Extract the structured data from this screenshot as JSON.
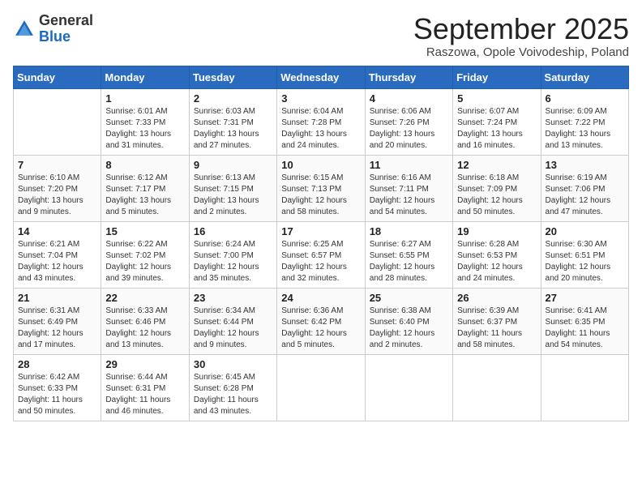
{
  "header": {
    "logo": {
      "general": "General",
      "blue": "Blue"
    },
    "title": "September 2025",
    "subtitle": "Raszowa, Opole Voivodeship, Poland"
  },
  "weekdays": [
    "Sunday",
    "Monday",
    "Tuesday",
    "Wednesday",
    "Thursday",
    "Friday",
    "Saturday"
  ],
  "weeks": [
    [
      {
        "day": "",
        "sunrise": "",
        "sunset": "",
        "daylight": ""
      },
      {
        "day": "1",
        "sunrise": "Sunrise: 6:01 AM",
        "sunset": "Sunset: 7:33 PM",
        "daylight": "Daylight: 13 hours and 31 minutes."
      },
      {
        "day": "2",
        "sunrise": "Sunrise: 6:03 AM",
        "sunset": "Sunset: 7:31 PM",
        "daylight": "Daylight: 13 hours and 27 minutes."
      },
      {
        "day": "3",
        "sunrise": "Sunrise: 6:04 AM",
        "sunset": "Sunset: 7:28 PM",
        "daylight": "Daylight: 13 hours and 24 minutes."
      },
      {
        "day": "4",
        "sunrise": "Sunrise: 6:06 AM",
        "sunset": "Sunset: 7:26 PM",
        "daylight": "Daylight: 13 hours and 20 minutes."
      },
      {
        "day": "5",
        "sunrise": "Sunrise: 6:07 AM",
        "sunset": "Sunset: 7:24 PM",
        "daylight": "Daylight: 13 hours and 16 minutes."
      },
      {
        "day": "6",
        "sunrise": "Sunrise: 6:09 AM",
        "sunset": "Sunset: 7:22 PM",
        "daylight": "Daylight: 13 hours and 13 minutes."
      }
    ],
    [
      {
        "day": "7",
        "sunrise": "Sunrise: 6:10 AM",
        "sunset": "Sunset: 7:20 PM",
        "daylight": "Daylight: 13 hours and 9 minutes."
      },
      {
        "day": "8",
        "sunrise": "Sunrise: 6:12 AM",
        "sunset": "Sunset: 7:17 PM",
        "daylight": "Daylight: 13 hours and 5 minutes."
      },
      {
        "day": "9",
        "sunrise": "Sunrise: 6:13 AM",
        "sunset": "Sunset: 7:15 PM",
        "daylight": "Daylight: 13 hours and 2 minutes."
      },
      {
        "day": "10",
        "sunrise": "Sunrise: 6:15 AM",
        "sunset": "Sunset: 7:13 PM",
        "daylight": "Daylight: 12 hours and 58 minutes."
      },
      {
        "day": "11",
        "sunrise": "Sunrise: 6:16 AM",
        "sunset": "Sunset: 7:11 PM",
        "daylight": "Daylight: 12 hours and 54 minutes."
      },
      {
        "day": "12",
        "sunrise": "Sunrise: 6:18 AM",
        "sunset": "Sunset: 7:09 PM",
        "daylight": "Daylight: 12 hours and 50 minutes."
      },
      {
        "day": "13",
        "sunrise": "Sunrise: 6:19 AM",
        "sunset": "Sunset: 7:06 PM",
        "daylight": "Daylight: 12 hours and 47 minutes."
      }
    ],
    [
      {
        "day": "14",
        "sunrise": "Sunrise: 6:21 AM",
        "sunset": "Sunset: 7:04 PM",
        "daylight": "Daylight: 12 hours and 43 minutes."
      },
      {
        "day": "15",
        "sunrise": "Sunrise: 6:22 AM",
        "sunset": "Sunset: 7:02 PM",
        "daylight": "Daylight: 12 hours and 39 minutes."
      },
      {
        "day": "16",
        "sunrise": "Sunrise: 6:24 AM",
        "sunset": "Sunset: 7:00 PM",
        "daylight": "Daylight: 12 hours and 35 minutes."
      },
      {
        "day": "17",
        "sunrise": "Sunrise: 6:25 AM",
        "sunset": "Sunset: 6:57 PM",
        "daylight": "Daylight: 12 hours and 32 minutes."
      },
      {
        "day": "18",
        "sunrise": "Sunrise: 6:27 AM",
        "sunset": "Sunset: 6:55 PM",
        "daylight": "Daylight: 12 hours and 28 minutes."
      },
      {
        "day": "19",
        "sunrise": "Sunrise: 6:28 AM",
        "sunset": "Sunset: 6:53 PM",
        "daylight": "Daylight: 12 hours and 24 minutes."
      },
      {
        "day": "20",
        "sunrise": "Sunrise: 6:30 AM",
        "sunset": "Sunset: 6:51 PM",
        "daylight": "Daylight: 12 hours and 20 minutes."
      }
    ],
    [
      {
        "day": "21",
        "sunrise": "Sunrise: 6:31 AM",
        "sunset": "Sunset: 6:49 PM",
        "daylight": "Daylight: 12 hours and 17 minutes."
      },
      {
        "day": "22",
        "sunrise": "Sunrise: 6:33 AM",
        "sunset": "Sunset: 6:46 PM",
        "daylight": "Daylight: 12 hours and 13 minutes."
      },
      {
        "day": "23",
        "sunrise": "Sunrise: 6:34 AM",
        "sunset": "Sunset: 6:44 PM",
        "daylight": "Daylight: 12 hours and 9 minutes."
      },
      {
        "day": "24",
        "sunrise": "Sunrise: 6:36 AM",
        "sunset": "Sunset: 6:42 PM",
        "daylight": "Daylight: 12 hours and 5 minutes."
      },
      {
        "day": "25",
        "sunrise": "Sunrise: 6:38 AM",
        "sunset": "Sunset: 6:40 PM",
        "daylight": "Daylight: 12 hours and 2 minutes."
      },
      {
        "day": "26",
        "sunrise": "Sunrise: 6:39 AM",
        "sunset": "Sunset: 6:37 PM",
        "daylight": "Daylight: 11 hours and 58 minutes."
      },
      {
        "day": "27",
        "sunrise": "Sunrise: 6:41 AM",
        "sunset": "Sunset: 6:35 PM",
        "daylight": "Daylight: 11 hours and 54 minutes."
      }
    ],
    [
      {
        "day": "28",
        "sunrise": "Sunrise: 6:42 AM",
        "sunset": "Sunset: 6:33 PM",
        "daylight": "Daylight: 11 hours and 50 minutes."
      },
      {
        "day": "29",
        "sunrise": "Sunrise: 6:44 AM",
        "sunset": "Sunset: 6:31 PM",
        "daylight": "Daylight: 11 hours and 46 minutes."
      },
      {
        "day": "30",
        "sunrise": "Sunrise: 6:45 AM",
        "sunset": "Sunset: 6:28 PM",
        "daylight": "Daylight: 11 hours and 43 minutes."
      },
      {
        "day": "",
        "sunrise": "",
        "sunset": "",
        "daylight": ""
      },
      {
        "day": "",
        "sunrise": "",
        "sunset": "",
        "daylight": ""
      },
      {
        "day": "",
        "sunrise": "",
        "sunset": "",
        "daylight": ""
      },
      {
        "day": "",
        "sunrise": "",
        "sunset": "",
        "daylight": ""
      }
    ]
  ]
}
